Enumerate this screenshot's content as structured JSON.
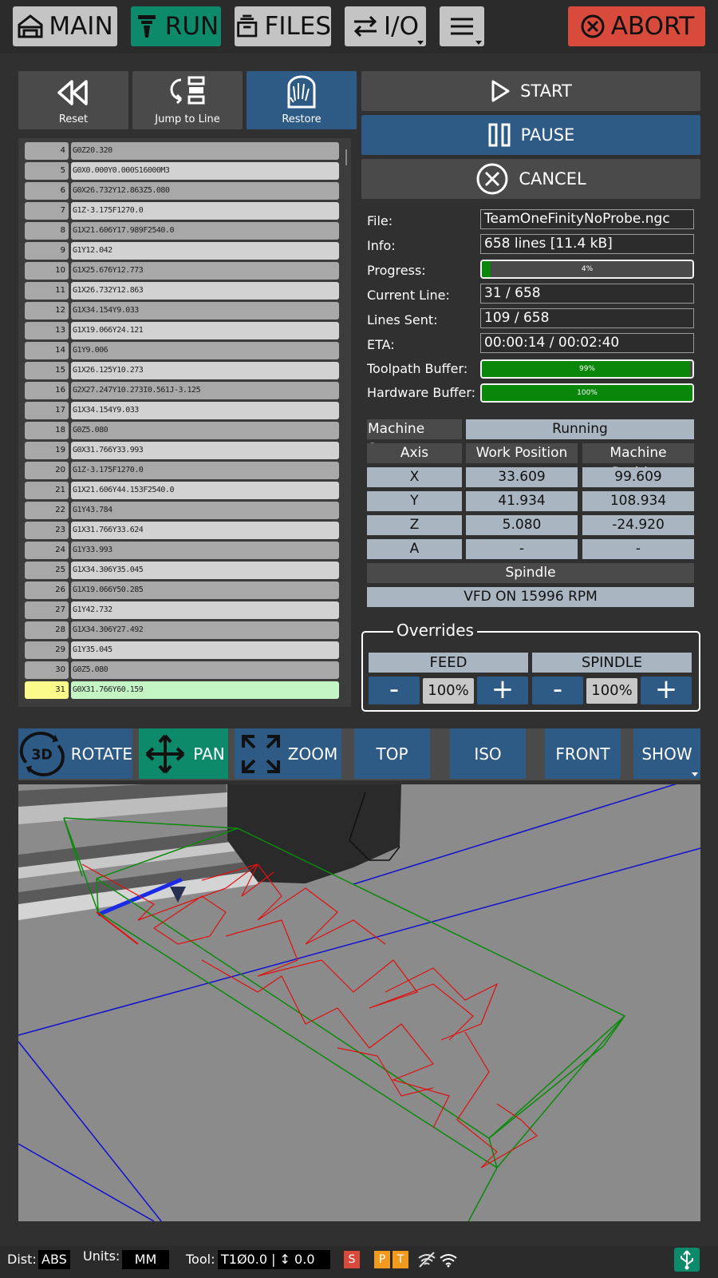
{
  "topbar": {
    "main": "MAIN",
    "run": "RUN",
    "files": "FILES",
    "io": "I/O",
    "abort": "ABORT"
  },
  "controls": {
    "reset": "Reset",
    "jump": "Jump to Line",
    "restore": "Restore",
    "start": "START",
    "pause": "PAUSE",
    "cancel": "CANCEL"
  },
  "gcode": [
    {
      "n": "4",
      "code": "G0Z20.320"
    },
    {
      "n": "5",
      "code": "G0X0.000Y0.000S16000M3"
    },
    {
      "n": "6",
      "code": "G0X26.732Y12.863Z5.080"
    },
    {
      "n": "7",
      "code": "G1Z-3.175F1270.0"
    },
    {
      "n": "8",
      "code": "G1X21.606Y17.989F2540.0"
    },
    {
      "n": "9",
      "code": "G1Y12.042"
    },
    {
      "n": "10",
      "code": "G1X25.676Y12.773"
    },
    {
      "n": "11",
      "code": "G1X26.732Y12.863"
    },
    {
      "n": "12",
      "code": "G1X34.154Y9.033"
    },
    {
      "n": "13",
      "code": "G1X19.066Y24.121"
    },
    {
      "n": "14",
      "code": "G1Y9.006"
    },
    {
      "n": "15",
      "code": "G1X26.125Y10.273"
    },
    {
      "n": "16",
      "code": "G2X27.247Y10.273I0.561J-3.125"
    },
    {
      "n": "17",
      "code": "G1X34.154Y9.033"
    },
    {
      "n": "18",
      "code": "G0Z5.080"
    },
    {
      "n": "19",
      "code": "G0X31.766Y33.993"
    },
    {
      "n": "20",
      "code": "G1Z-3.175F1270.0"
    },
    {
      "n": "21",
      "code": "G1X21.606Y44.153F2540.0"
    },
    {
      "n": "22",
      "code": "G1Y43.784"
    },
    {
      "n": "23",
      "code": "G1X31.766Y33.624"
    },
    {
      "n": "24",
      "code": "G1Y33.993"
    },
    {
      "n": "25",
      "code": "G1X34.306Y35.045"
    },
    {
      "n": "26",
      "code": "G1X19.066Y50.285"
    },
    {
      "n": "27",
      "code": "G1Y42.732"
    },
    {
      "n": "28",
      "code": "G1X34.306Y27.492"
    },
    {
      "n": "29",
      "code": "G1Y35.045"
    },
    {
      "n": "30",
      "code": "G0Z5.080"
    },
    {
      "n": "31",
      "code": "G0X31.766Y60.159"
    }
  ],
  "info": {
    "file_label": "File:",
    "file": "TeamOneFinityNoProbe.ngc",
    "info_label": "Info:",
    "info": "658 lines [11.4 kB]",
    "progress_label": "Progress:",
    "progress": 0.04,
    "progress_text": "4%",
    "current_label": "Current Line:",
    "current": "31 / 658",
    "sent_label": "Lines Sent:",
    "sent": "109 / 658",
    "eta_label": "ETA:",
    "eta": "00:00:14 / 00:02:40",
    "toolpath_label": "Toolpath Buffer:",
    "toolpath": 0.99,
    "toolpath_text": "99%",
    "hardware_label": "Hardware Buffer:",
    "hardware": 1.0,
    "hardware_text": "100%"
  },
  "machine": {
    "state_label": "Machine State:",
    "state": "Running",
    "axis_header": "Axis",
    "work_header": "Work Position",
    "machine_header": "Machine Position",
    "axes": [
      {
        "axis": "X",
        "work": "33.609",
        "machine": "99.609"
      },
      {
        "axis": "Y",
        "work": "41.934",
        "machine": "108.934"
      },
      {
        "axis": "Z",
        "work": "5.080",
        "machine": "-24.920"
      },
      {
        "axis": "A",
        "work": "-",
        "machine": "-"
      }
    ],
    "spindle_label": "Spindle",
    "spindle": "VFD ON 15996 RPM"
  },
  "overrides": {
    "title": "Overrides",
    "feed_label": "FEED",
    "spindle_label": "SPINDLE",
    "minus": "-",
    "plus": "+",
    "feed": "100%",
    "spindle": "100%"
  },
  "view": {
    "rotate": "ROTATE",
    "pan": "PAN",
    "zoom": "ZOOM",
    "top": "TOP",
    "iso": "ISO",
    "front": "FRONT",
    "show": "SHOW",
    "icon_3d": "3D"
  },
  "status": {
    "dist_label": "Dist:",
    "dist": "ABS",
    "units_label": "Units:",
    "units": "MM",
    "tool_label": "Tool:",
    "tool": "T1Ø0.0 | ↕ 0.0",
    "s_flag": "S",
    "p_flag": "P",
    "t_flag": "T"
  },
  "colors": {
    "run_active": "#0c8a6a",
    "abort": "#d84a3c",
    "button_blue": "#2e5a86",
    "current_line": "#c4f5c4",
    "current_num": "#fbfb8c",
    "buffer_green": "#0a860a"
  }
}
